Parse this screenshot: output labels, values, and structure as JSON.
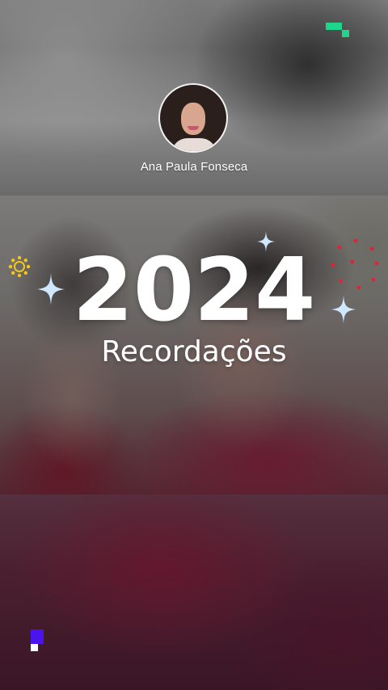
{
  "profile": {
    "name": "Ana Paula  Fonseca"
  },
  "story": {
    "year": "2024",
    "subtitle": "Recordações"
  },
  "colors": {
    "brand_green": "#1fd58b",
    "brand_purple": "#4a14f0",
    "sparkle": "#cfe8ff",
    "sun_yellow": "#f5c518",
    "dot_red": "#e3223a"
  },
  "icons": [
    "brand-mark-icon",
    "sun-icon",
    "sparkle-icon",
    "confetti-dots-icon",
    "corner-logo-icon"
  ]
}
